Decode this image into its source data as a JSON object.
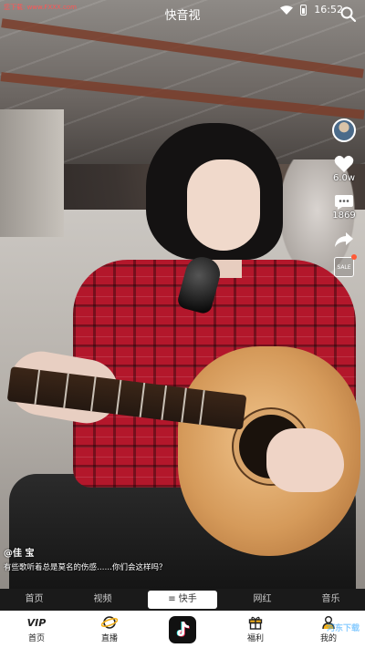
{
  "status_bar": {
    "source_url": "您下载: www.FXXX.com",
    "app_title": "快音视",
    "time": "16:52"
  },
  "video": {
    "author": "@佳 宝",
    "caption": "有些歌听着总是莫名的伤感……你们会这样吗？"
  },
  "actions": {
    "likes": "6.0w",
    "comments": "1869",
    "sale_label": "SALE"
  },
  "channel_tabs": [
    {
      "label": "首页",
      "active": false
    },
    {
      "label": "视频",
      "active": false
    },
    {
      "label": "≡ 快手",
      "active": true
    },
    {
      "label": "网红",
      "active": false
    },
    {
      "label": "音乐",
      "active": false
    }
  ],
  "bottom_nav": {
    "vip_icon_text": "VIP",
    "items": [
      {
        "label": "首页",
        "icon": "vip-icon"
      },
      {
        "label": "直播",
        "icon": "live-icon"
      },
      {
        "label": "",
        "icon": "tiktok-icon"
      },
      {
        "label": "福利",
        "icon": "gift-icon"
      },
      {
        "label": "我的",
        "icon": "profile-icon"
      }
    ]
  },
  "watermark": "河东下载",
  "colors": {
    "bottom_bg": "#ffffff",
    "tab_bar_bg": "#1a1a1a",
    "active_tab_bg": "#ffffff",
    "accent_red": "#b3172b"
  }
}
